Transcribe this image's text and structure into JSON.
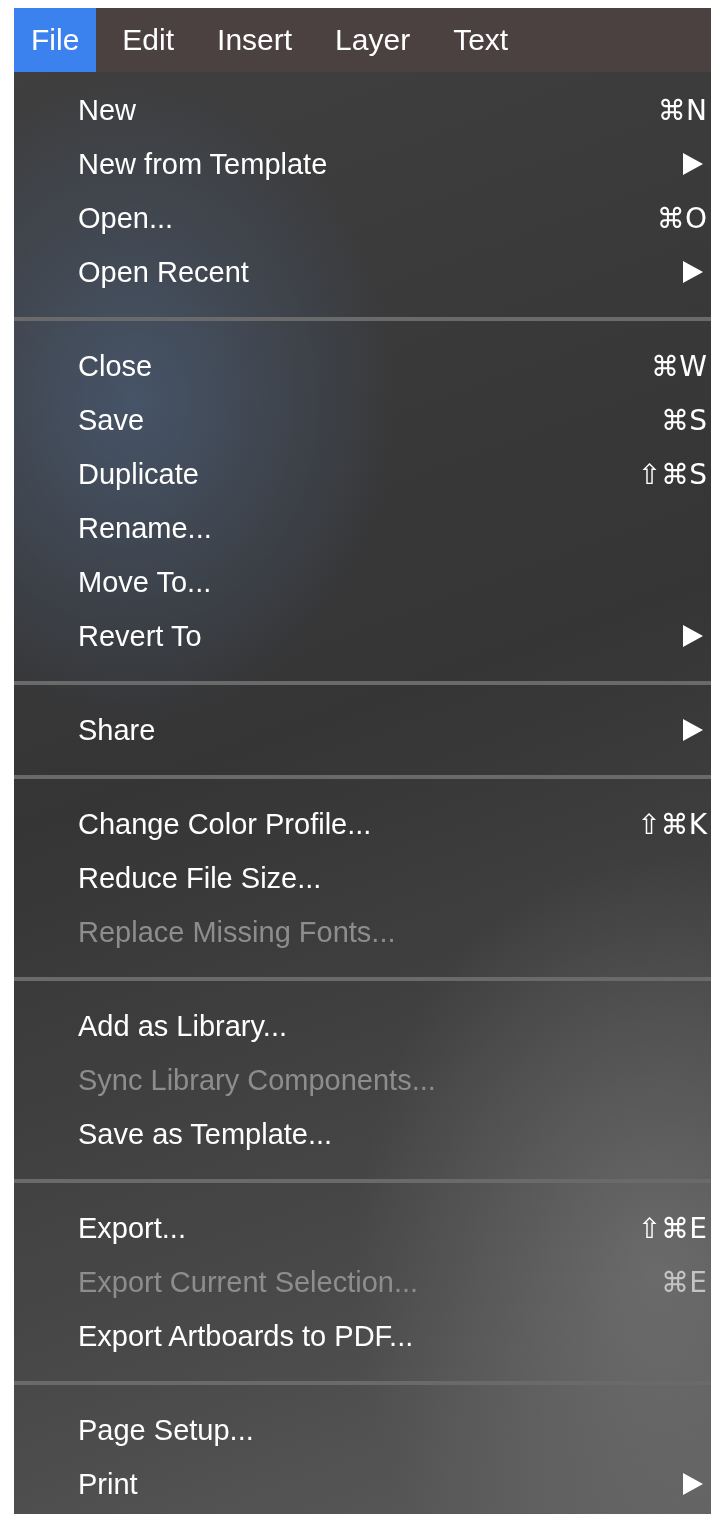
{
  "menubar": [
    {
      "label": "File",
      "selected": true
    },
    {
      "label": "Edit",
      "selected": false
    },
    {
      "label": "Insert",
      "selected": false
    },
    {
      "label": "Layer",
      "selected": false
    },
    {
      "label": "Text",
      "selected": false
    }
  ],
  "groups": [
    {
      "items": [
        {
          "label": "New",
          "shortcut": "⌘N",
          "submenu": false,
          "disabled": false
        },
        {
          "label": "New from Template",
          "submenu": true,
          "disabled": false
        },
        {
          "label": "Open...",
          "shortcut": "⌘O",
          "submenu": false,
          "disabled": false
        },
        {
          "label": "Open Recent",
          "submenu": true,
          "disabled": false
        }
      ]
    },
    {
      "items": [
        {
          "label": "Close",
          "shortcut": "⌘W",
          "submenu": false,
          "disabled": false
        },
        {
          "label": "Save",
          "shortcut": "⌘S",
          "submenu": false,
          "disabled": false
        },
        {
          "label": "Duplicate",
          "shortcut": "⇧⌘S",
          "submenu": false,
          "disabled": false
        },
        {
          "label": "Rename...",
          "submenu": false,
          "disabled": false
        },
        {
          "label": "Move To...",
          "submenu": false,
          "disabled": false
        },
        {
          "label": "Revert To",
          "submenu": true,
          "disabled": false
        }
      ]
    },
    {
      "items": [
        {
          "label": "Share",
          "submenu": true,
          "disabled": false
        }
      ]
    },
    {
      "items": [
        {
          "label": "Change Color Profile...",
          "shortcut": "⇧⌘K",
          "submenu": false,
          "disabled": false
        },
        {
          "label": "Reduce File Size...",
          "submenu": false,
          "disabled": false
        },
        {
          "label": "Replace Missing Fonts...",
          "submenu": false,
          "disabled": true
        }
      ]
    },
    {
      "items": [
        {
          "label": "Add as Library...",
          "submenu": false,
          "disabled": false
        },
        {
          "label": "Sync Library Components...",
          "submenu": false,
          "disabled": true
        },
        {
          "label": "Save as Template...",
          "submenu": false,
          "disabled": false
        }
      ]
    },
    {
      "items": [
        {
          "label": "Export...",
          "shortcut": "⇧⌘E",
          "submenu": false,
          "disabled": false
        },
        {
          "label": "Export Current Selection...",
          "shortcut": "⌘E",
          "submenu": false,
          "disabled": true
        },
        {
          "label": "Export Artboards to PDF...",
          "submenu": false,
          "disabled": false
        }
      ]
    },
    {
      "items": [
        {
          "label": "Page Setup...",
          "submenu": false,
          "disabled": false
        },
        {
          "label": "Print",
          "submenu": true,
          "disabled": false
        }
      ]
    }
  ]
}
